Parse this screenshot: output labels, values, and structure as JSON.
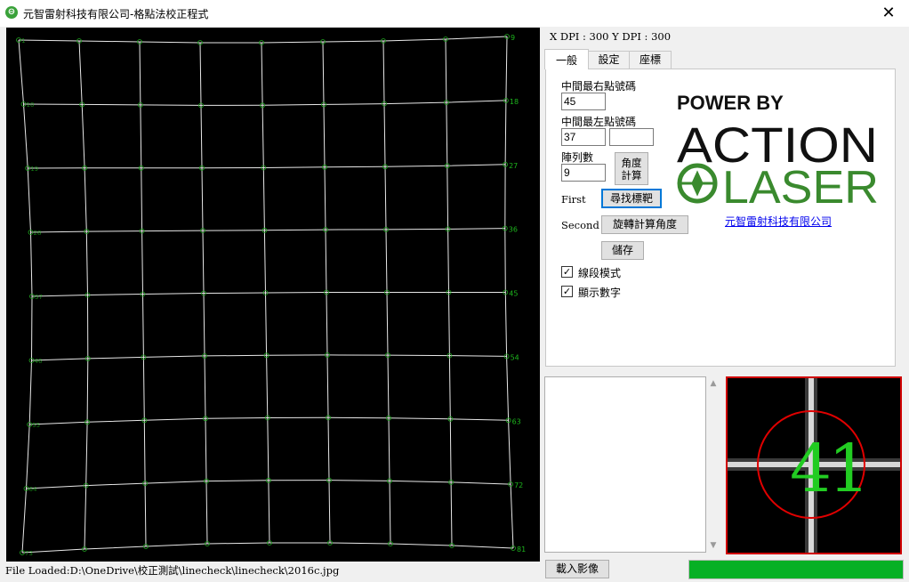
{
  "window": {
    "title": "元智雷射科技有限公司-格點法校正程式",
    "close_glyph": "✕",
    "icon_glyph": "⊖"
  },
  "header": {
    "dpi_text": "X DPI : 300 Y DPI : 300"
  },
  "tabs": [
    {
      "label": "一般",
      "active": true
    },
    {
      "label": "設定",
      "active": false
    },
    {
      "label": "座標",
      "active": false
    }
  ],
  "general": {
    "right_point_label": "中間最右點號碼",
    "right_point_value": "45",
    "left_point_label": "中間最左點號碼",
    "left_point_value": "37",
    "left_point_extra_value": "",
    "array_count_label": "陣列數",
    "array_count_value": "9",
    "angle_calc_label": "角度計算",
    "first_label": "First",
    "find_target_label": "尋找標靶",
    "second_label": "Second",
    "rotate_calc_label": "旋轉計算角度",
    "save_label": "儲存",
    "line_mode_label": "線段模式",
    "line_mode_checked": true,
    "show_numbers_label": "顯示數字",
    "show_numbers_checked": true
  },
  "logo": {
    "power_by": "POWER BY",
    "word1": "ACTION",
    "word2": "LASER",
    "company_link": "元智雷射科技有限公司",
    "brand_green": "#3a8a2e"
  },
  "footer": {
    "status_text": "File Loaded:D:\\OneDrive\\校正測試\\linecheck\\linecheck\\2016c.jpg",
    "load_image_label": "載入影像",
    "progress_fraction": 1.0,
    "progress_color": "#06b025"
  },
  "grid": {
    "rows": 9,
    "cols": 9,
    "line_color": "#e8e8e8",
    "label_color": "#1db51d",
    "marker_color": "#22aa22",
    "right_labels": [
      "9",
      "18",
      "27",
      "36",
      "45",
      "54",
      "63",
      "72",
      "81"
    ],
    "left_labels": [
      "1",
      "10",
      "19",
      "28",
      "37",
      "46",
      "55",
      "64",
      "73"
    ]
  },
  "zoom": {
    "label": "41",
    "circle_color": "#e00000",
    "text_color": "#22cc22"
  }
}
